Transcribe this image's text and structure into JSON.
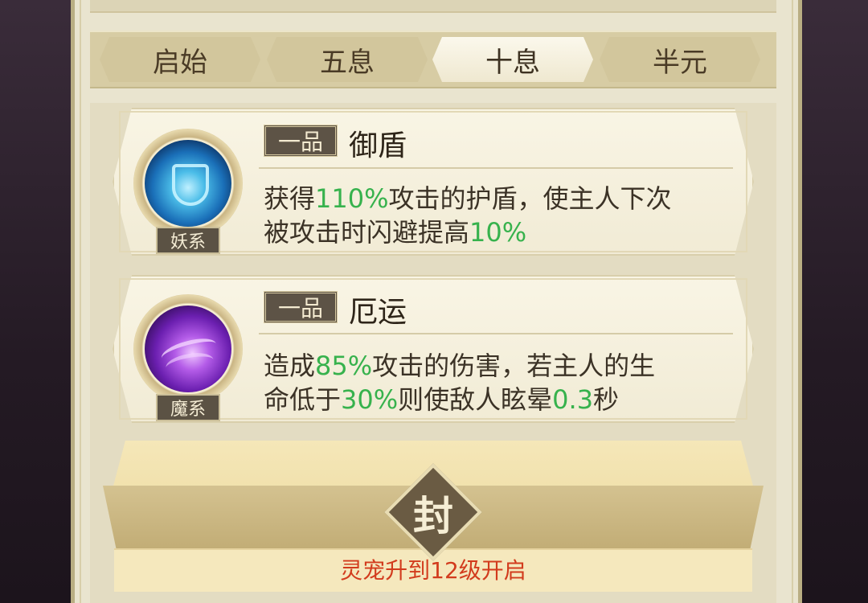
{
  "tabs": [
    {
      "label": "启始",
      "active": false
    },
    {
      "label": "五息",
      "active": false
    },
    {
      "label": "十息",
      "active": true
    },
    {
      "label": "半元",
      "active": false
    }
  ],
  "skills": [
    {
      "grade": "一品",
      "name": "御盾",
      "element": "妖系",
      "icon": "shield-skill-icon",
      "desc_line1_parts": [
        "获得",
        "110%",
        "攻击的护盾，使主人下次"
      ],
      "desc_line2_parts": [
        "被攻击时闪避提高",
        "10%"
      ]
    },
    {
      "grade": "一品",
      "name": "厄运",
      "element": "魔系",
      "icon": "vortex-skill-icon",
      "desc_line1_parts": [
        "造成",
        "85%",
        "攻击的伤害，若主人的生"
      ],
      "desc_line2_parts": [
        "命低于",
        "30%",
        "则使敌人眩晕",
        "0.3",
        "秒"
      ]
    }
  ],
  "locked_slot": {
    "seal_char": "封",
    "unlock_text": "灵宠升到12级开启"
  },
  "colors": {
    "highlight": "#37b24d",
    "unlock_text": "#d23b1d"
  }
}
